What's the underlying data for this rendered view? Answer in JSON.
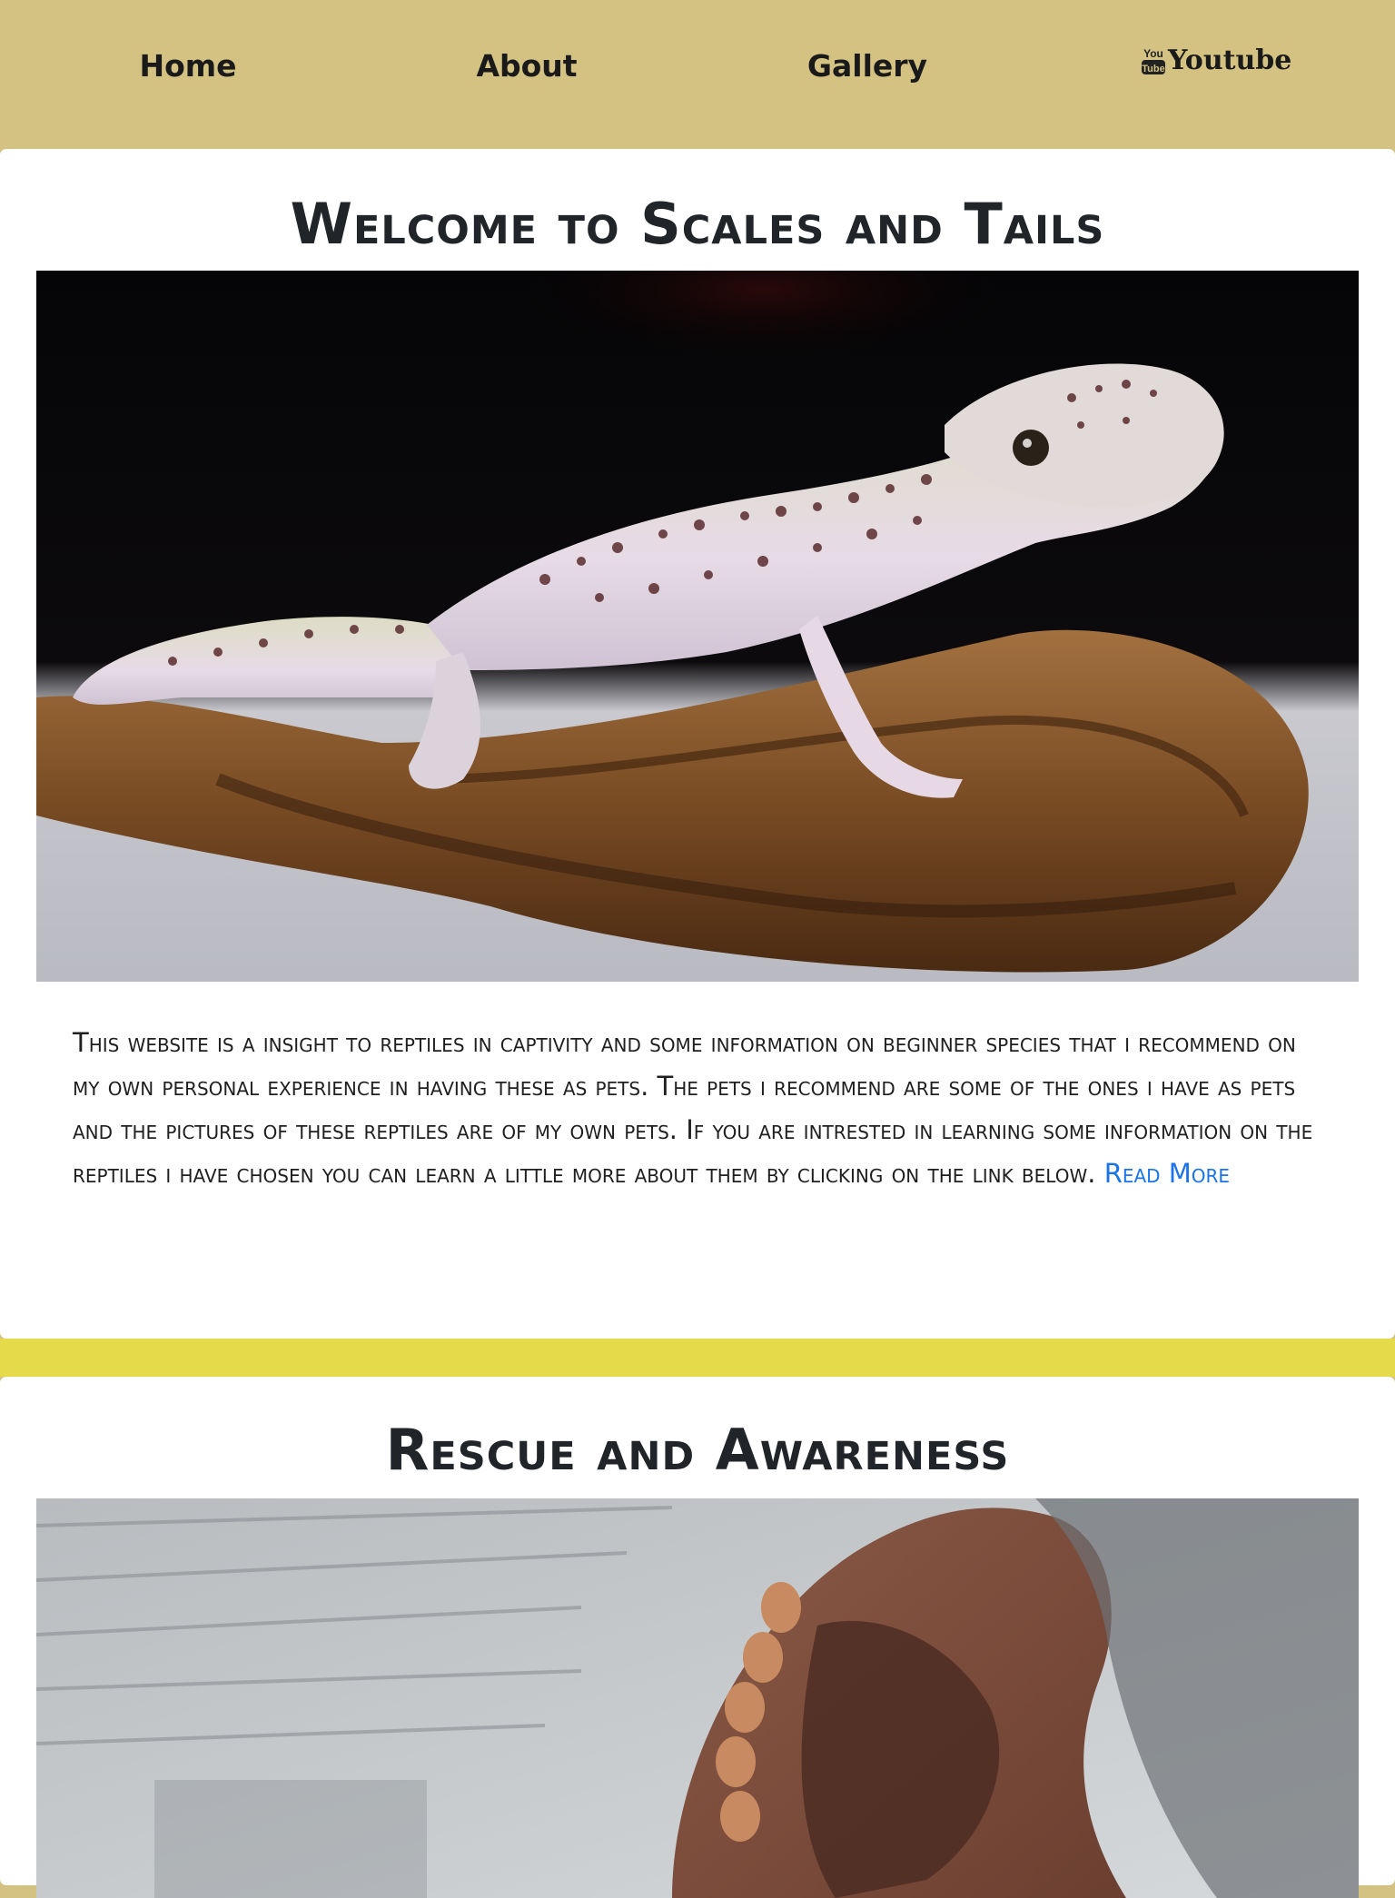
{
  "nav": {
    "items": [
      {
        "label": "Home"
      },
      {
        "label": "About"
      },
      {
        "label": "Gallery"
      },
      {
        "label": "Youtube",
        "icon": "youtube-icon"
      }
    ]
  },
  "welcome": {
    "title": "Welcome to Scales and Tails",
    "image_alt": "leopard-gecko-photo",
    "text": "This website is a insight to reptiles in captivity and some information on beginner species that i recommend on my own personal experience in having these as pets. The pets i recommend are some of the ones i have as pets and the pictures of these reptiles are of my own pets. If you are intrested in learning some information on the reptiles i have chosen you can learn a little more about them by clicking on the link below.",
    "link_label": "Read More"
  },
  "rescue": {
    "title": "Rescue and Awareness",
    "image_alt": "rescue-reptile-photo"
  },
  "colors": {
    "nav_bg": "#d4c283",
    "divider_band": "#e5da4a",
    "link": "#1a73e8",
    "card_bg": "#ffffff"
  }
}
